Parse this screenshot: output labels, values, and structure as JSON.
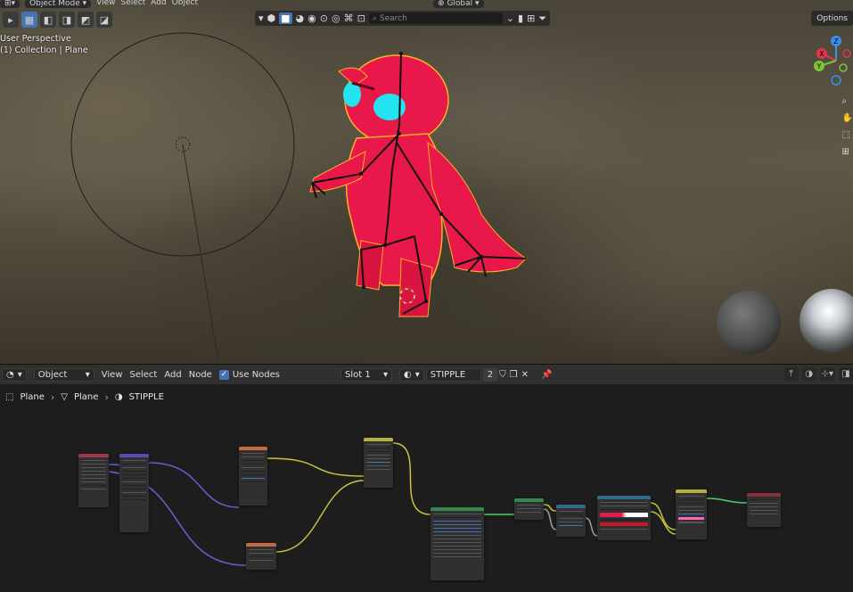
{
  "viewport": {
    "header": {
      "mode_label": "Object Mode",
      "menus": [
        "View",
        "Select",
        "Add",
        "Object"
      ],
      "orientation": "Global",
      "search_placeholder": "Search",
      "options_label": "Options"
    },
    "info": {
      "perspective": "User Perspective",
      "collection": "(1) Collection | Plane"
    },
    "gizmo_axes": [
      "Z",
      "X",
      "Y"
    ],
    "colors": {
      "character": "#e8184a",
      "eyes": "#22e3ee",
      "outline": "#ffb020",
      "axis_x": "#e0364d",
      "axis_y": "#7fc437",
      "axis_z": "#3c8fe6"
    }
  },
  "node_editor": {
    "header": {
      "editor_icon": "node-editor-icon",
      "object_dropdown": "Object",
      "menus": [
        "View",
        "Select",
        "Add",
        "Node"
      ],
      "use_nodes_label": "Use Nodes",
      "slot_label": "Slot 1",
      "material_name": "STIPPLE",
      "user_count": "2"
    },
    "breadcrumb": {
      "object": "Plane",
      "mesh": "Plane",
      "material": "STIPPLE"
    },
    "colors": {
      "header_input": "#9c3a4a",
      "header_vector": "#5a4db0",
      "header_texture": "#c56a3c",
      "header_color": "#b4b13a",
      "header_shader": "#2f8a4c",
      "header_converter": "#2e6c8a",
      "header_output": "#8a2f3c",
      "link_vector": "#6a5fd0",
      "link_color": "#c9c43a",
      "link_shader": "#4fd06a",
      "link_float": "#a0a0a0"
    }
  }
}
